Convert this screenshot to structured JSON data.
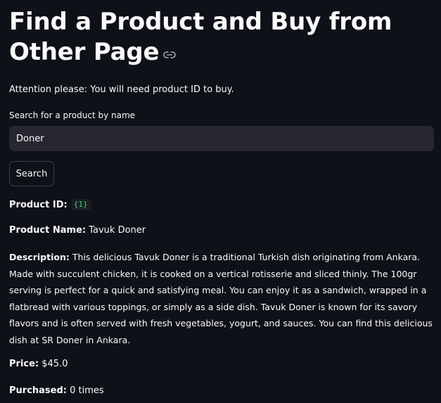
{
  "header": {
    "title": "Find a Product and Buy from Other Page",
    "link_icon": "link-icon"
  },
  "notice": {
    "text": "Attention please: You will need product ID to buy."
  },
  "search": {
    "label": "Search for a product by name",
    "value": "Doner",
    "button_label": "Search"
  },
  "result": {
    "product_id_label": "Product ID:",
    "product_id_value": "{1}",
    "product_name_label": "Product Name:",
    "product_name_value": "Tavuk Doner",
    "description_label": "Description:",
    "description_value": "This delicious Tavuk Doner is a traditional Turkish dish originating from Ankara. Made with succulent chicken, it is cooked on a vertical rotisserie and sliced thinly. The 100gr serving is perfect for a quick and satisfying meal. You can enjoy it as a sandwich, wrapped in a flatbread with various toppings, or simply as a side dish. Tavuk Doner is known for its savory flavors and is often served with fresh vegetables, yogurt, and sauces. You can find this delicious dish at SR Doner in Ankara.",
    "price_label": "Price:",
    "price_value": "$45.0",
    "purchased_label": "Purchased:",
    "purchased_value": "0 times"
  },
  "colors": {
    "background": "#0e1117",
    "text": "#fafafa",
    "input_background": "#262730",
    "code_text": "#3dd56d"
  }
}
